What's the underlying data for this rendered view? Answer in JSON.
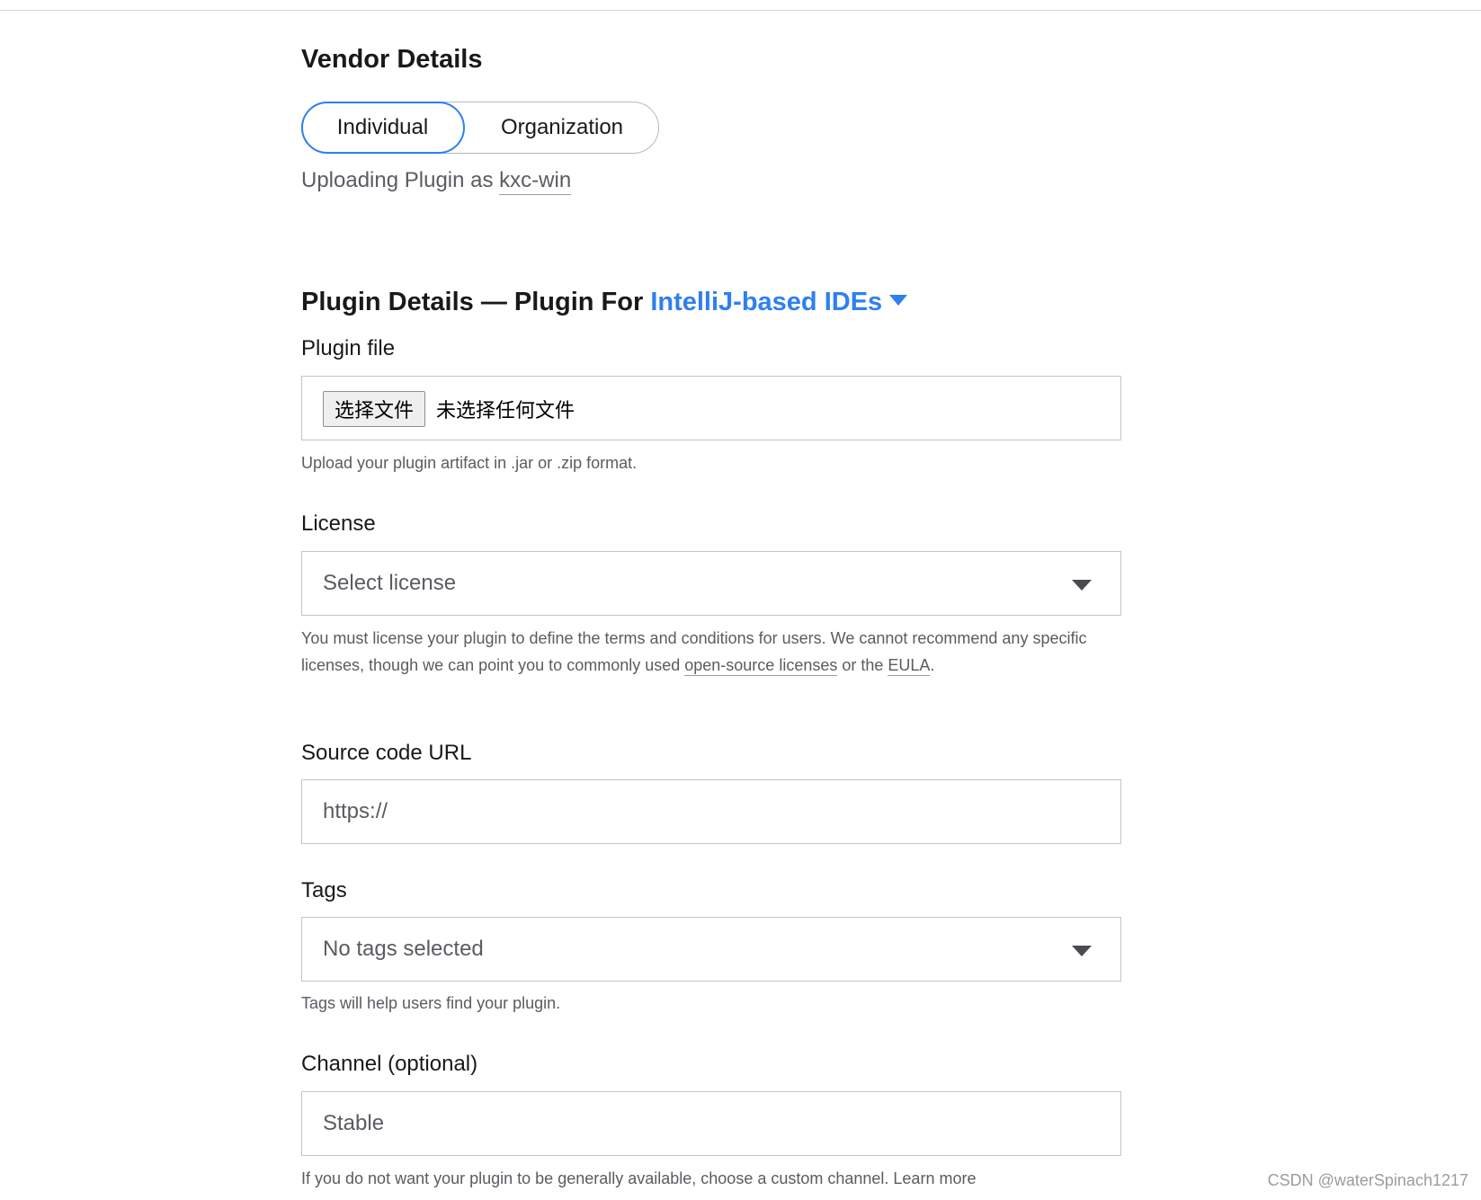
{
  "vendor": {
    "title": "Vendor Details",
    "toggle": {
      "individual": "Individual",
      "organization": "Organization",
      "selected": "Individual"
    },
    "uploading_prefix": "Uploading Plugin as ",
    "username": "kxc-win"
  },
  "plugin": {
    "title_prefix": "Plugin Details — Plugin For ",
    "ide_link": "IntelliJ-based IDEs",
    "file": {
      "label": "Plugin file",
      "button": "选择文件",
      "status": "未选择任何文件",
      "hint": "Upload your plugin artifact in .jar or .zip format."
    },
    "license": {
      "label": "License",
      "value": "Select license",
      "hint_part1": "You must license your plugin to define the terms and conditions for users. We cannot recommend any specific licenses, though we can point you to commonly used ",
      "hint_link1": "open-source licenses",
      "hint_part2": " or the ",
      "hint_link2": "EULA",
      "hint_part3": "."
    },
    "source": {
      "label": "Source code URL",
      "placeholder": "https://"
    },
    "tags": {
      "label": "Tags",
      "value": "No tags selected",
      "hint": "Tags will help users find your plugin."
    },
    "channel": {
      "label": "Channel (optional)",
      "value": "Stable",
      "hint": "If you do not want your plugin to be generally available, choose a custom channel. Learn more"
    }
  },
  "watermark": "CSDN @waterSpinach1217",
  "colors": {
    "accent": "#2f7ff0",
    "text": "#19191c",
    "muted": "#5b5b62",
    "border": "#c4c4c8"
  }
}
